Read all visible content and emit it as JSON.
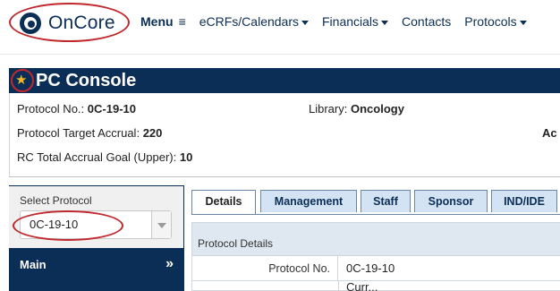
{
  "topnav": {
    "logo_text": "OnCore",
    "items": [
      {
        "label": "Menu",
        "icon": "hamburger-icon"
      },
      {
        "label": "eCRFs/Calendars"
      },
      {
        "label": "Financials"
      },
      {
        "label": "Contacts"
      },
      {
        "label": "Protocols"
      }
    ]
  },
  "page": {
    "title": "PC Console"
  },
  "info": {
    "protocol_no_label": "Protocol No.:",
    "protocol_no_value": "0C-19-10",
    "library_label": "Library:",
    "library_value": "Oncology",
    "target_accrual_label": "Protocol Target Accrual:",
    "target_accrual_value": "220",
    "ac_partial": "Ac",
    "rc_goal_label": "RC Total Accrual Goal (Upper):",
    "rc_goal_value": "10"
  },
  "sidebar": {
    "select_label": "Select Protocol",
    "select_value": "0C-19-10",
    "main_label": "Main",
    "main_arrow": "»"
  },
  "tabs": [
    {
      "label": "Details",
      "active": true
    },
    {
      "label": "Management",
      "active": false
    },
    {
      "label": "Staff",
      "active": false
    },
    {
      "label": "Sponsor",
      "active": false
    },
    {
      "label": "IND/IDE",
      "active": false
    }
  ],
  "details": {
    "header": "Protocol Details",
    "rows": [
      {
        "label": "Protocol No.",
        "value": "0C-19-10"
      }
    ],
    "partial_row_value": "Curr..."
  },
  "colors": {
    "navy": "#0b2e57",
    "highlight_red": "#c0282d",
    "star_gold": "#f0b628",
    "tab_blue": "#d4e3f3"
  }
}
